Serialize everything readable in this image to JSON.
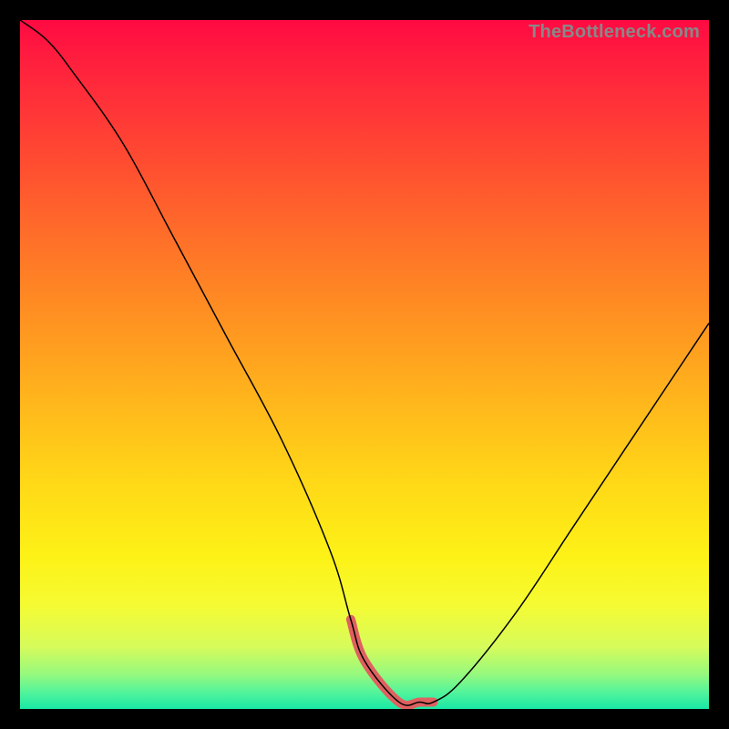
{
  "watermark": "TheBottleneck.com",
  "chart_data": {
    "type": "line",
    "title": "",
    "xlabel": "",
    "ylabel": "",
    "xlim": [
      0,
      100
    ],
    "ylim": [
      0,
      100
    ],
    "series": [
      {
        "name": "bottleneck-curve",
        "x": [
          0,
          4,
          8,
          15,
          22,
          30,
          38,
          45,
          48,
          50,
          55,
          58,
          60,
          64,
          72,
          80,
          88,
          96,
          100
        ],
        "values": [
          100,
          97,
          92,
          82,
          69,
          54,
          39,
          23,
          13,
          7,
          1,
          1,
          1,
          4,
          14,
          26,
          38,
          50,
          56
        ]
      },
      {
        "name": "optimal-range",
        "x": [
          48,
          50,
          55,
          58,
          60
        ],
        "values": [
          13,
          7,
          1,
          1,
          1
        ]
      }
    ]
  }
}
